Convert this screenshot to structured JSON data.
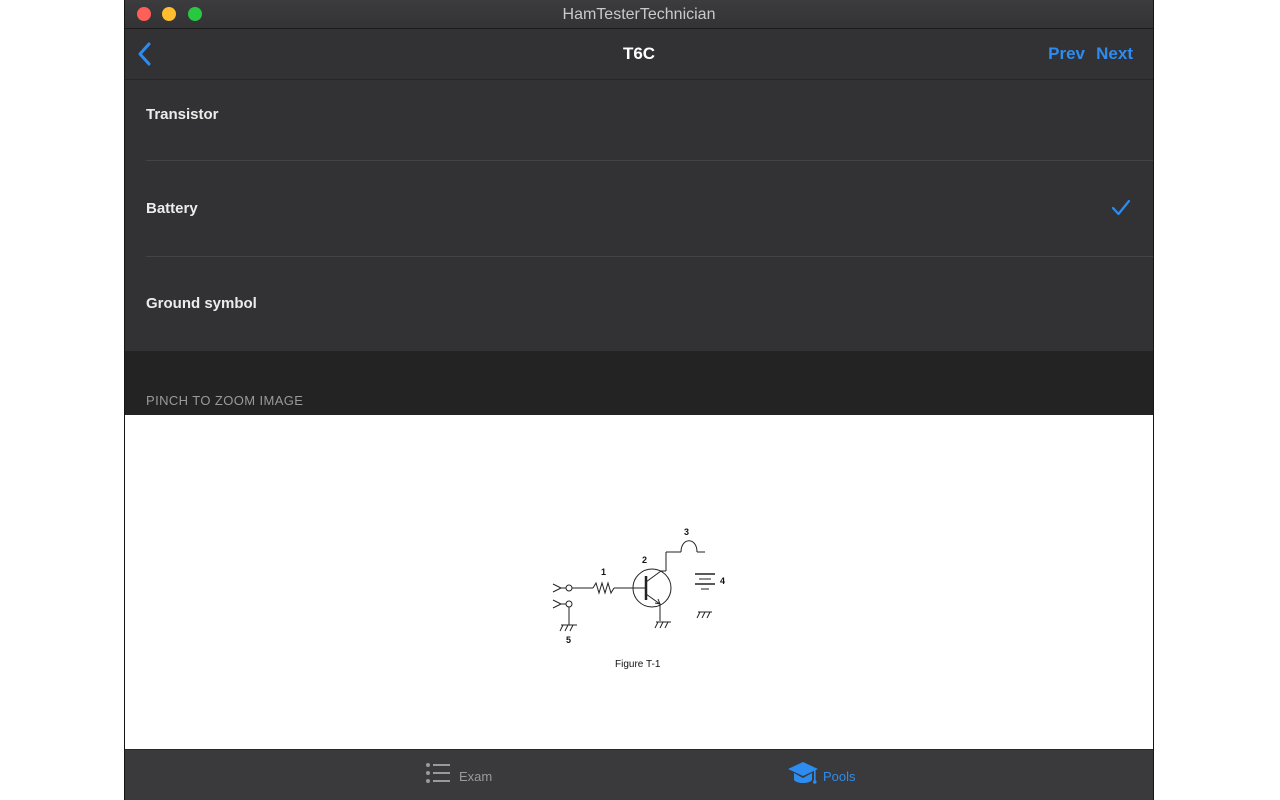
{
  "window": {
    "title": "HamTesterTechnician"
  },
  "navbar": {
    "title": "T6C",
    "prev_label": "Prev",
    "next_label": "Next"
  },
  "answers": [
    {
      "label": "Transistor",
      "selected": false
    },
    {
      "label": "Battery",
      "selected": true
    },
    {
      "label": "Ground symbol",
      "selected": false
    }
  ],
  "image_section": {
    "header": "PINCH TO ZOOM IMAGE",
    "figure_caption": "Figure T-1",
    "component_numbers": [
      "1",
      "2",
      "3",
      "4",
      "5"
    ]
  },
  "tabbar": {
    "items": [
      {
        "label": "Exam",
        "icon": "list-icon",
        "active": false
      },
      {
        "label": "Pools",
        "icon": "graduation-cap-icon",
        "active": true
      }
    ]
  },
  "colors": {
    "accent": "#2d8cf0",
    "background": "#323234",
    "traffic_close": "#fe5f57",
    "traffic_minimize": "#febc2e",
    "traffic_zoom": "#28c840"
  }
}
